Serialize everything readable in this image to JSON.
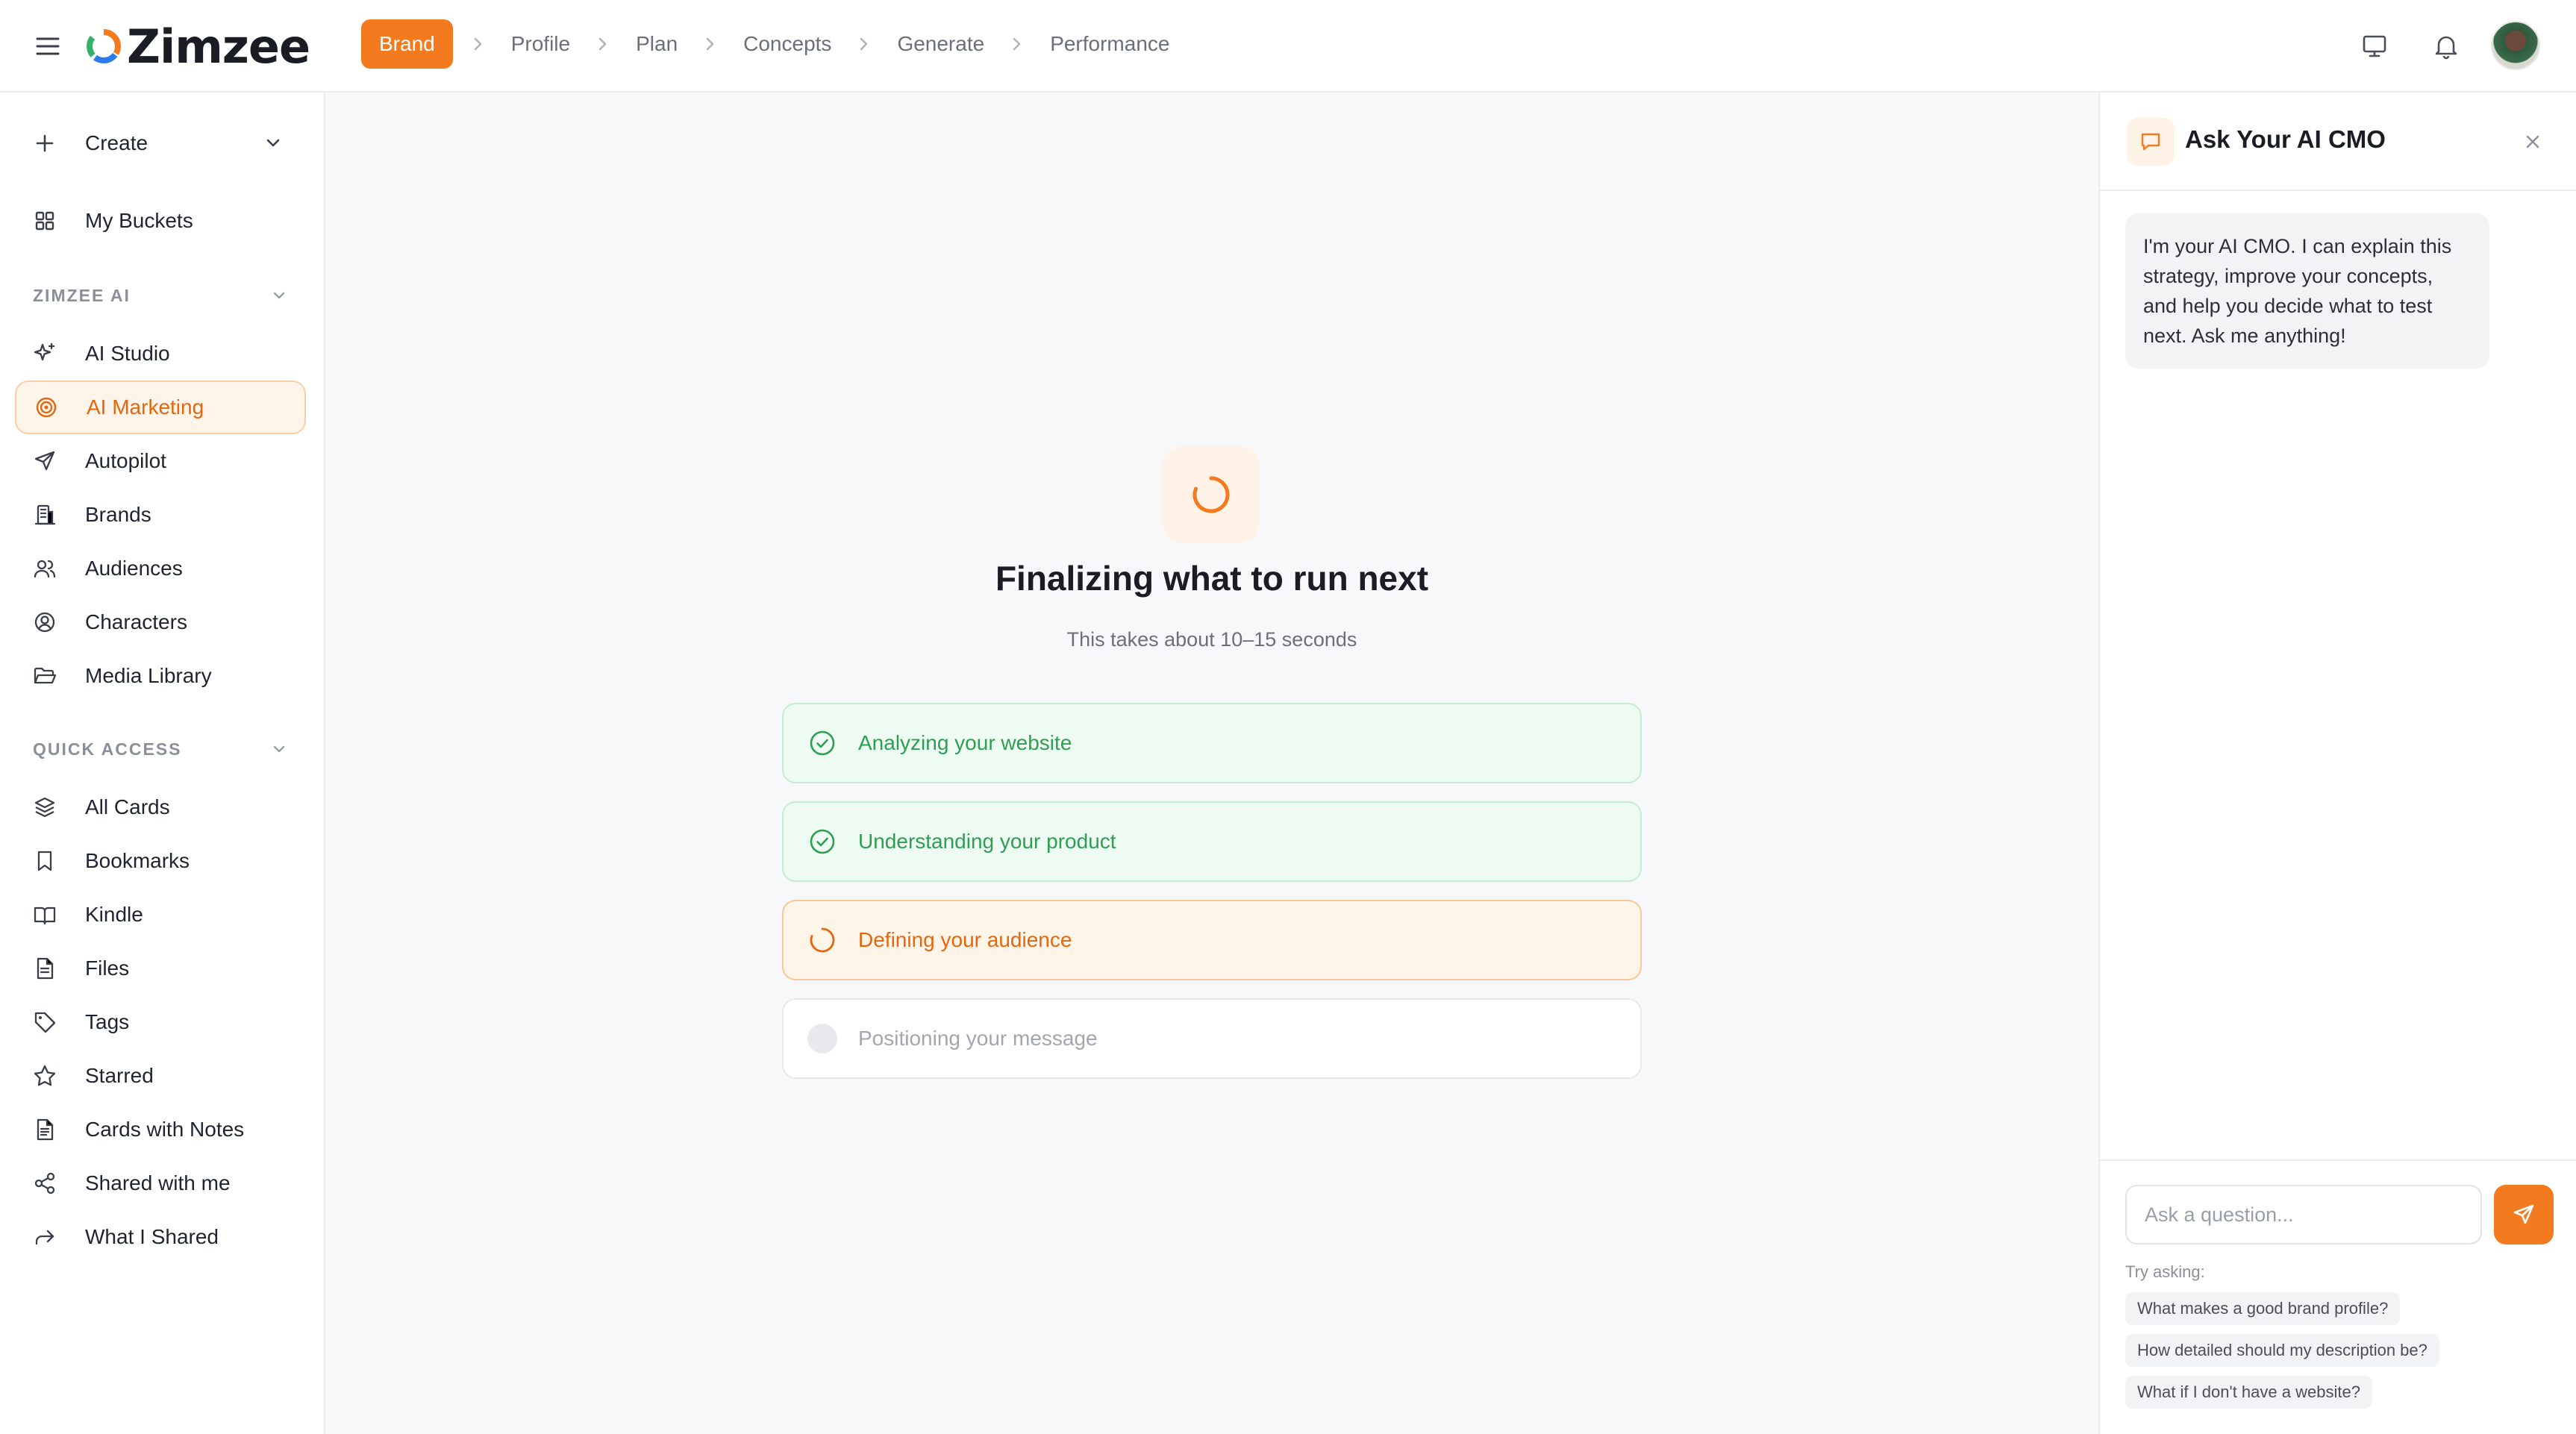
{
  "app": {
    "name": "Zimzee"
  },
  "steps": [
    {
      "label": "Brand"
    },
    {
      "label": "Profile"
    },
    {
      "label": "Plan"
    },
    {
      "label": "Concepts"
    },
    {
      "label": "Generate"
    },
    {
      "label": "Performance"
    }
  ],
  "sidebar": {
    "create_label": "Create",
    "my_buckets": "My Buckets",
    "section_ai": "ZIMZEE AI",
    "ai_items": [
      {
        "label": "AI Studio",
        "icon": "sparkles-icon"
      },
      {
        "label": "AI Marketing",
        "icon": "target-icon"
      },
      {
        "label": "Autopilot",
        "icon": "send-icon"
      },
      {
        "label": "Brands",
        "icon": "building-icon"
      },
      {
        "label": "Audiences",
        "icon": "users-icon"
      },
      {
        "label": "Characters",
        "icon": "user-circle-icon"
      },
      {
        "label": "Media Library",
        "icon": "folder-open-icon"
      }
    ],
    "section_quick": "QUICK ACCESS",
    "quick_items": [
      {
        "label": "All Cards",
        "icon": "layers-icon"
      },
      {
        "label": "Bookmarks",
        "icon": "bookmark-icon"
      },
      {
        "label": "Kindle",
        "icon": "book-open-icon"
      },
      {
        "label": "Files",
        "icon": "file-icon"
      },
      {
        "label": "Tags",
        "icon": "tag-icon"
      },
      {
        "label": "Starred",
        "icon": "star-icon"
      },
      {
        "label": "Cards with Notes",
        "icon": "file-text-icon"
      },
      {
        "label": "Shared with me",
        "icon": "share-icon"
      },
      {
        "label": "What I Shared",
        "icon": "forward-icon"
      }
    ]
  },
  "main": {
    "title": "Finalizing what to run next",
    "subtitle": "This takes about 10–15 seconds",
    "tasks": [
      {
        "label": "Analyzing your website",
        "status": "done"
      },
      {
        "label": "Understanding your product",
        "status": "done"
      },
      {
        "label": "Defining your audience",
        "status": "active"
      },
      {
        "label": "Positioning your message",
        "status": "pending"
      }
    ]
  },
  "chat": {
    "title": "Ask Your AI CMO",
    "message": "I'm your AI CMO. I can explain this strategy, improve your concepts, and help you decide what to test next. Ask me anything!",
    "input_placeholder": "Ask a question...",
    "try_label": "Try asking:",
    "suggestions": [
      "What makes a good brand profile?",
      "How detailed should my description be?",
      "What if I don't have a website?"
    ]
  },
  "colors": {
    "accent": "#f47a1f",
    "success": "#2e9e52",
    "active_bg": "#fff4e8"
  }
}
